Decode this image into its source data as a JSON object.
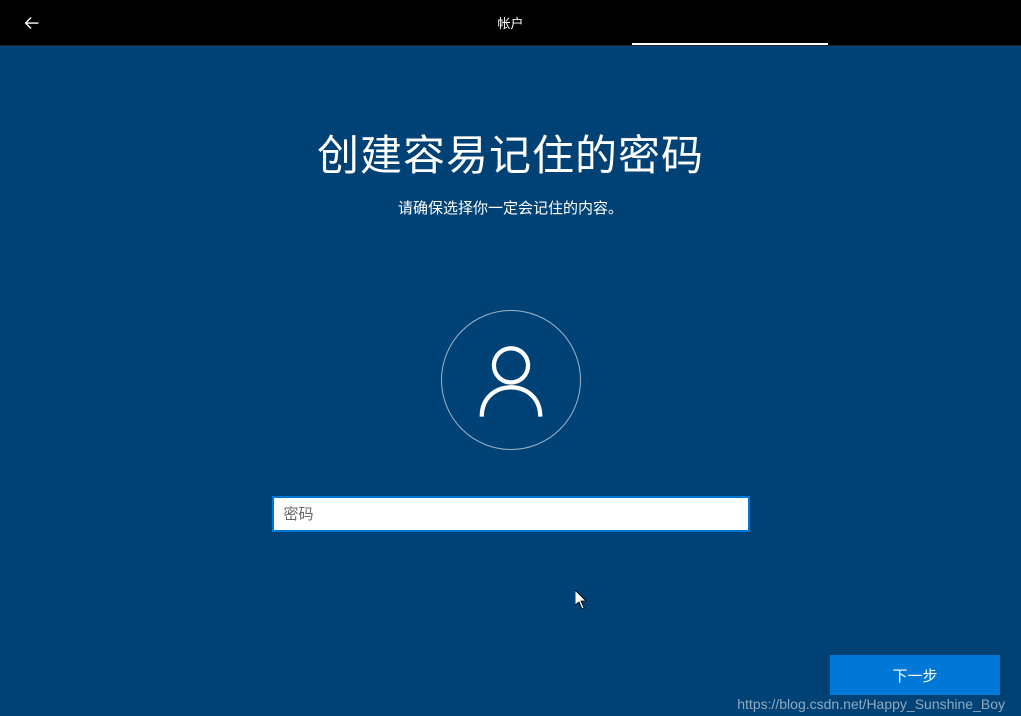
{
  "header": {
    "title": "帐户"
  },
  "main": {
    "title": "创建容易记住的密码",
    "subtitle": "请确保选择你一定会记住的内容。"
  },
  "form": {
    "password_placeholder": "密码",
    "password_value": ""
  },
  "actions": {
    "next_label": "下一步"
  },
  "watermark": "https://blog.csdn.net/Happy_Sunshine_Boy"
}
